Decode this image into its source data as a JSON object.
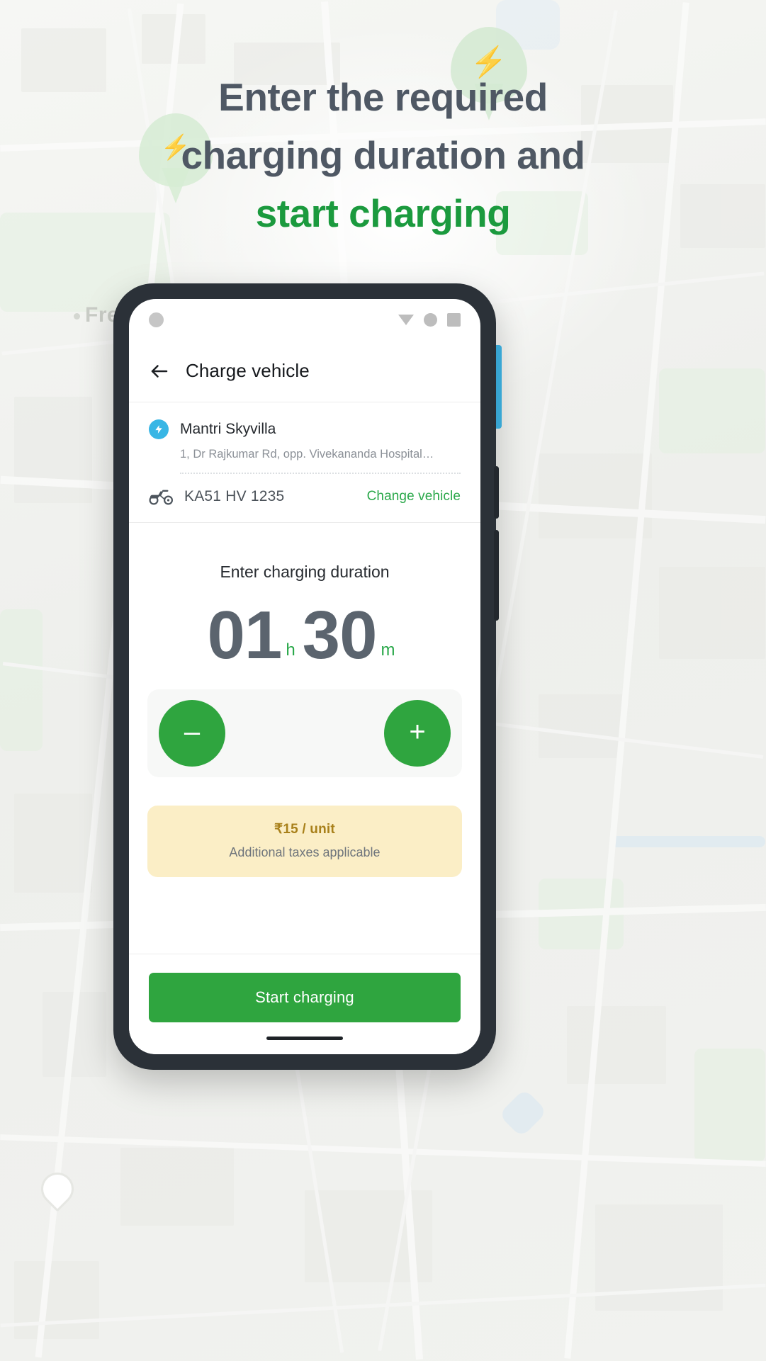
{
  "headline": {
    "line1": "Enter the required",
    "line2": "charging duration and",
    "line3": "start charging"
  },
  "background": {
    "map_label": "FreshMenu",
    "colors": {
      "accent_green": "#1b9a3e",
      "headline_gray": "#4f5864",
      "brand_green": "#2fa53f",
      "info_blue": "#38b6e5",
      "price_bg": "#fbeec6",
      "price_text": "#a8801a"
    }
  },
  "phone": {
    "statusbar": {
      "icons": [
        "camera-dot",
        "dropdown-triangle",
        "circle-indicator",
        "square-indicator"
      ]
    },
    "appbar": {
      "back_icon": "back-arrow-icon",
      "title": "Charge vehicle"
    },
    "station": {
      "badge_icon": "bolt-icon",
      "name": "Mantri Skyvilla",
      "address": "1, Dr Rajkumar Rd, opp. Vivekananda Hospital…"
    },
    "vehicle": {
      "icon": "scooter-icon",
      "plate": "KA51 HV 1235",
      "change_label": "Change vehicle"
    },
    "duration": {
      "label": "Enter charging duration",
      "hours": "01",
      "hours_unit": "h",
      "minutes": "30",
      "minutes_unit": "m",
      "decrement_label": "–",
      "increment_label": "+"
    },
    "price": {
      "rate": "₹15 / unit",
      "note": "Additional taxes applicable"
    },
    "cta": {
      "label": "Start charging"
    }
  }
}
